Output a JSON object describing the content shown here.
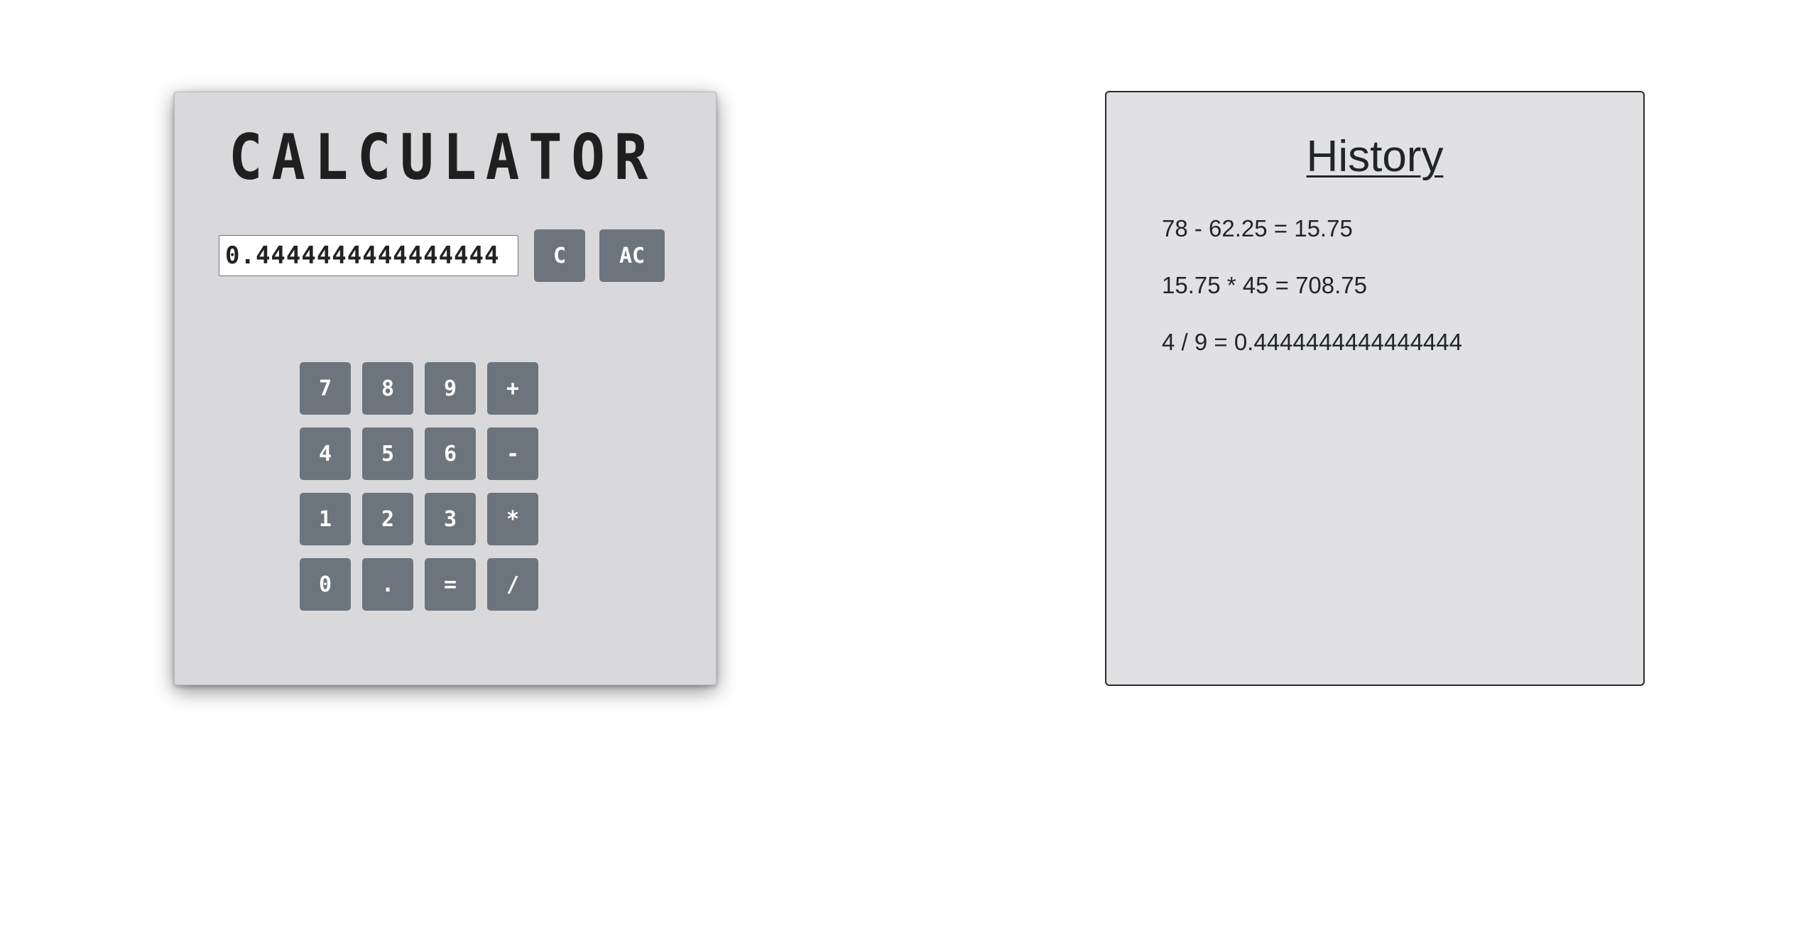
{
  "calculator": {
    "title": "CALCULATOR",
    "display_value": "0.4444444444444444",
    "clear_label": "C",
    "all_clear_label": "AC",
    "keys": [
      "7",
      "8",
      "9",
      "+",
      "4",
      "5",
      "6",
      "-",
      "1",
      "2",
      "3",
      "*",
      "0",
      ".",
      "=",
      "/"
    ]
  },
  "history": {
    "title": "History",
    "entries": [
      "78 - 62.25 = 15.75",
      "15.75 * 45 = 708.75",
      "4 / 9 = 0.4444444444444444"
    ]
  },
  "colors": {
    "button_bg": "#6c757d",
    "calculator_bg": "#d9d9db",
    "history_bg": "#e1e1e3"
  }
}
